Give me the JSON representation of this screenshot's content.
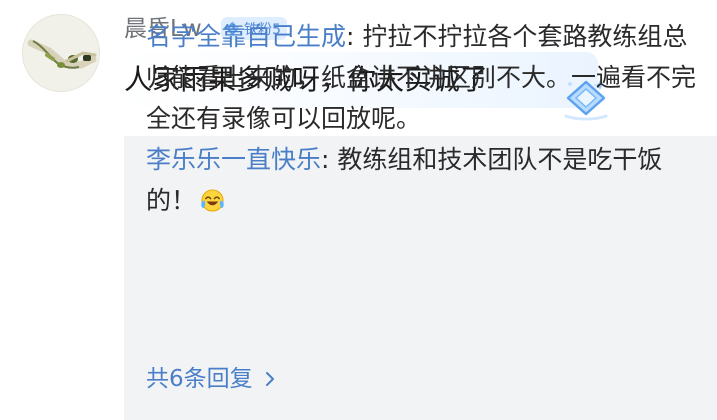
{
  "comment": {
    "username": "晨昏Lw",
    "badge_label": "铁粉5",
    "badge_icon": "diamond-icon",
    "text": "人家雨果多贼呀，你太实诚了",
    "decoration_icon": "diamond-sticker-icon"
  },
  "replies": [
    {
      "author": "名字全靠自己生成",
      "separator": ":",
      "text": " 拧拉不拧拉各个套路教练组总归能看出来的，纸盒讲不讲区别不大。一遍看不完全还有录像可以回放呢。"
    },
    {
      "author": "李乐乐一直快乐",
      "separator": ":",
      "text": " 教练组和技术团队不是吃干饭的！",
      "emoji": "laughing-tears-emoji"
    }
  ],
  "more_replies": {
    "label": "共6条回复",
    "icon": "chevron-right-icon"
  },
  "colors": {
    "link_blue": "#4a7fc8",
    "username_gray": "#6f737a",
    "panel_gray": "#f2f3f5",
    "badge_bg": "#dfeefe"
  }
}
